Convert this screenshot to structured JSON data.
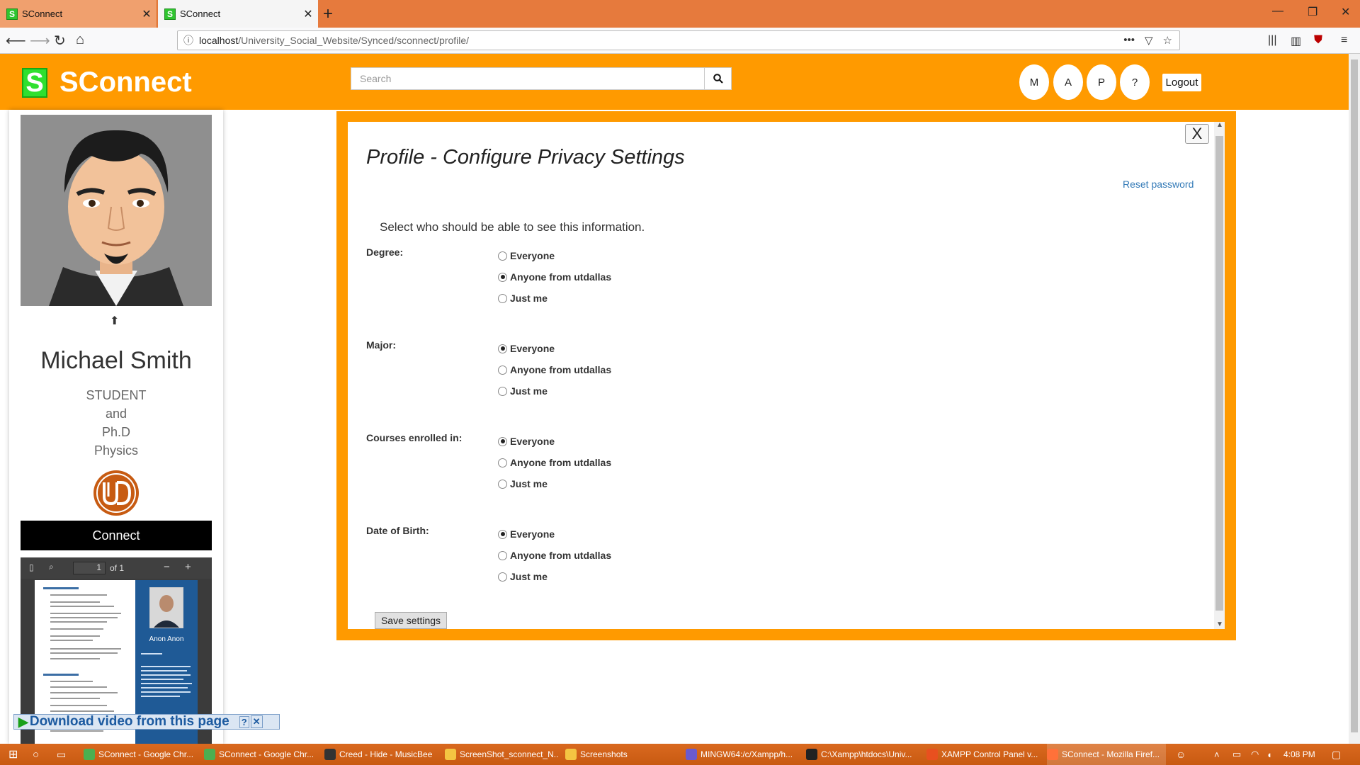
{
  "browser": {
    "tabs": [
      {
        "title": "SConnect"
      },
      {
        "title": "SConnect"
      }
    ],
    "url_host": "localhost",
    "url_path": "/University_Social_Website/Synced/sconnect/profile/"
  },
  "header": {
    "logo_letter": "S",
    "brand": "SConnect",
    "search_placeholder": "Search",
    "circle_buttons": [
      "M",
      "A",
      "P",
      "?"
    ],
    "logout_label": "Logout"
  },
  "profile": {
    "name": "Michael Smith",
    "role_lines": [
      "STUDENT",
      "and",
      "Ph.D",
      "Physics"
    ],
    "connect_label": "Connect",
    "pdf": {
      "page_number": "1",
      "page_total": "of 1",
      "side_name": "Anon Anon"
    }
  },
  "download_bar": {
    "label": "Download video from this page"
  },
  "modal": {
    "close_label": "X",
    "title": "Profile - Configure Privacy Settings",
    "reset_link": "Reset password",
    "intro": "Select who should be able to see this information.",
    "settings": [
      {
        "label": "Degree:",
        "options": [
          "Everyone",
          "Anyone from utdallas",
          "Just me"
        ],
        "selected": 1
      },
      {
        "label": "Major:",
        "options": [
          "Everyone",
          "Anyone from utdallas",
          "Just me"
        ],
        "selected": 0
      },
      {
        "label": "Courses enrolled in:",
        "options": [
          "Everyone",
          "Anyone from utdallas",
          "Just me"
        ],
        "selected": 0
      },
      {
        "label": "Date of Birth:",
        "options": [
          "Everyone",
          "Anyone from utdallas",
          "Just me"
        ],
        "selected": 0
      }
    ],
    "save_label": "Save settings"
  },
  "taskbar": {
    "items": [
      "SConnect - Google Chr...",
      "SConnect - Google Chr...",
      "Creed - Hide - MusicBee",
      "ScreenShot_sconnect_N...",
      "Screenshots",
      "MINGW64:/c/Xampp/h...",
      "C:\\Xampp\\htdocs\\Univ...",
      "XAMPP Control Panel v...",
      "SConnect - Mozilla Firef..."
    ],
    "clock": "4:08 PM"
  }
}
